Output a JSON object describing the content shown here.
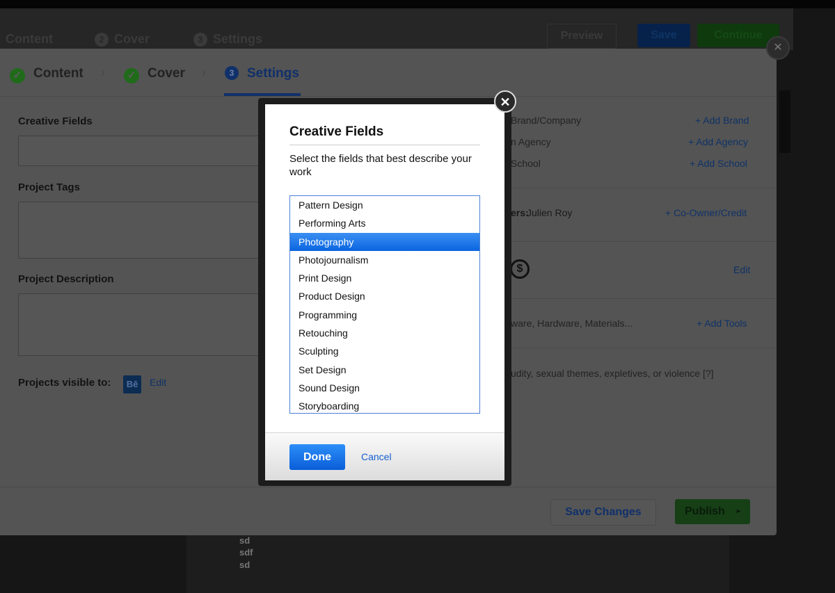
{
  "background_header": {
    "breadcrumb": [
      "Content",
      "Cover",
      "Settings"
    ],
    "breadcrumb_numbers": [
      "2",
      "3"
    ],
    "preview_label": "Preview",
    "save_label": "Save",
    "continue_label": "Continue"
  },
  "panel": {
    "tabs": [
      {
        "label": "Content",
        "status": "done"
      },
      {
        "label": "Cover",
        "status": "done"
      },
      {
        "label": "Settings",
        "number": "3",
        "status": "active"
      }
    ],
    "left": {
      "creative_fields_label": "Creative Fields",
      "project_tags_label": "Project Tags",
      "project_description_label": "Project Description",
      "visible_to_label": "Projects visible to:",
      "behance_icon_text": "Bē",
      "edit_label": "Edit"
    },
    "right": {
      "brand_label": "Brand/Company",
      "add_brand": "+ Add Brand",
      "agency_label": "n Agency",
      "add_agency": "+ Add Agency",
      "school_label": "School",
      "add_school": "+ Add School",
      "owners_label": "ers:",
      "owners_value": "Julien Roy",
      "add_coowner": "+ Co-Owner/Credit",
      "license_edit": "Edit",
      "tools_label": "ware, Hardware, Materials...",
      "add_tools": "+ Add Tools",
      "mature_text": "udity, sexual themes, expletives, or violence [?]"
    },
    "footer": {
      "save_changes": "Save Changes",
      "publish": "Publish"
    }
  },
  "background_bottom_text": [
    "sd",
    "sdf",
    "sd"
  ],
  "dialog": {
    "title": "Creative Fields",
    "description": "Select the fields that best describe your work",
    "options": [
      "Pattern Design",
      "Performing Arts",
      "Photography",
      "Photojournalism",
      "Print Design",
      "Product Design",
      "Programming",
      "Retouching",
      "Sculpting",
      "Set Design",
      "Sound Design",
      "Storyboarding"
    ],
    "selected": "Photography",
    "done_label": "Done",
    "cancel_label": "Cancel",
    "close_icon": "close-icon"
  },
  "colors": {
    "accent_blue": "#0a65e0",
    "publish_green": "#2a8a2a"
  }
}
